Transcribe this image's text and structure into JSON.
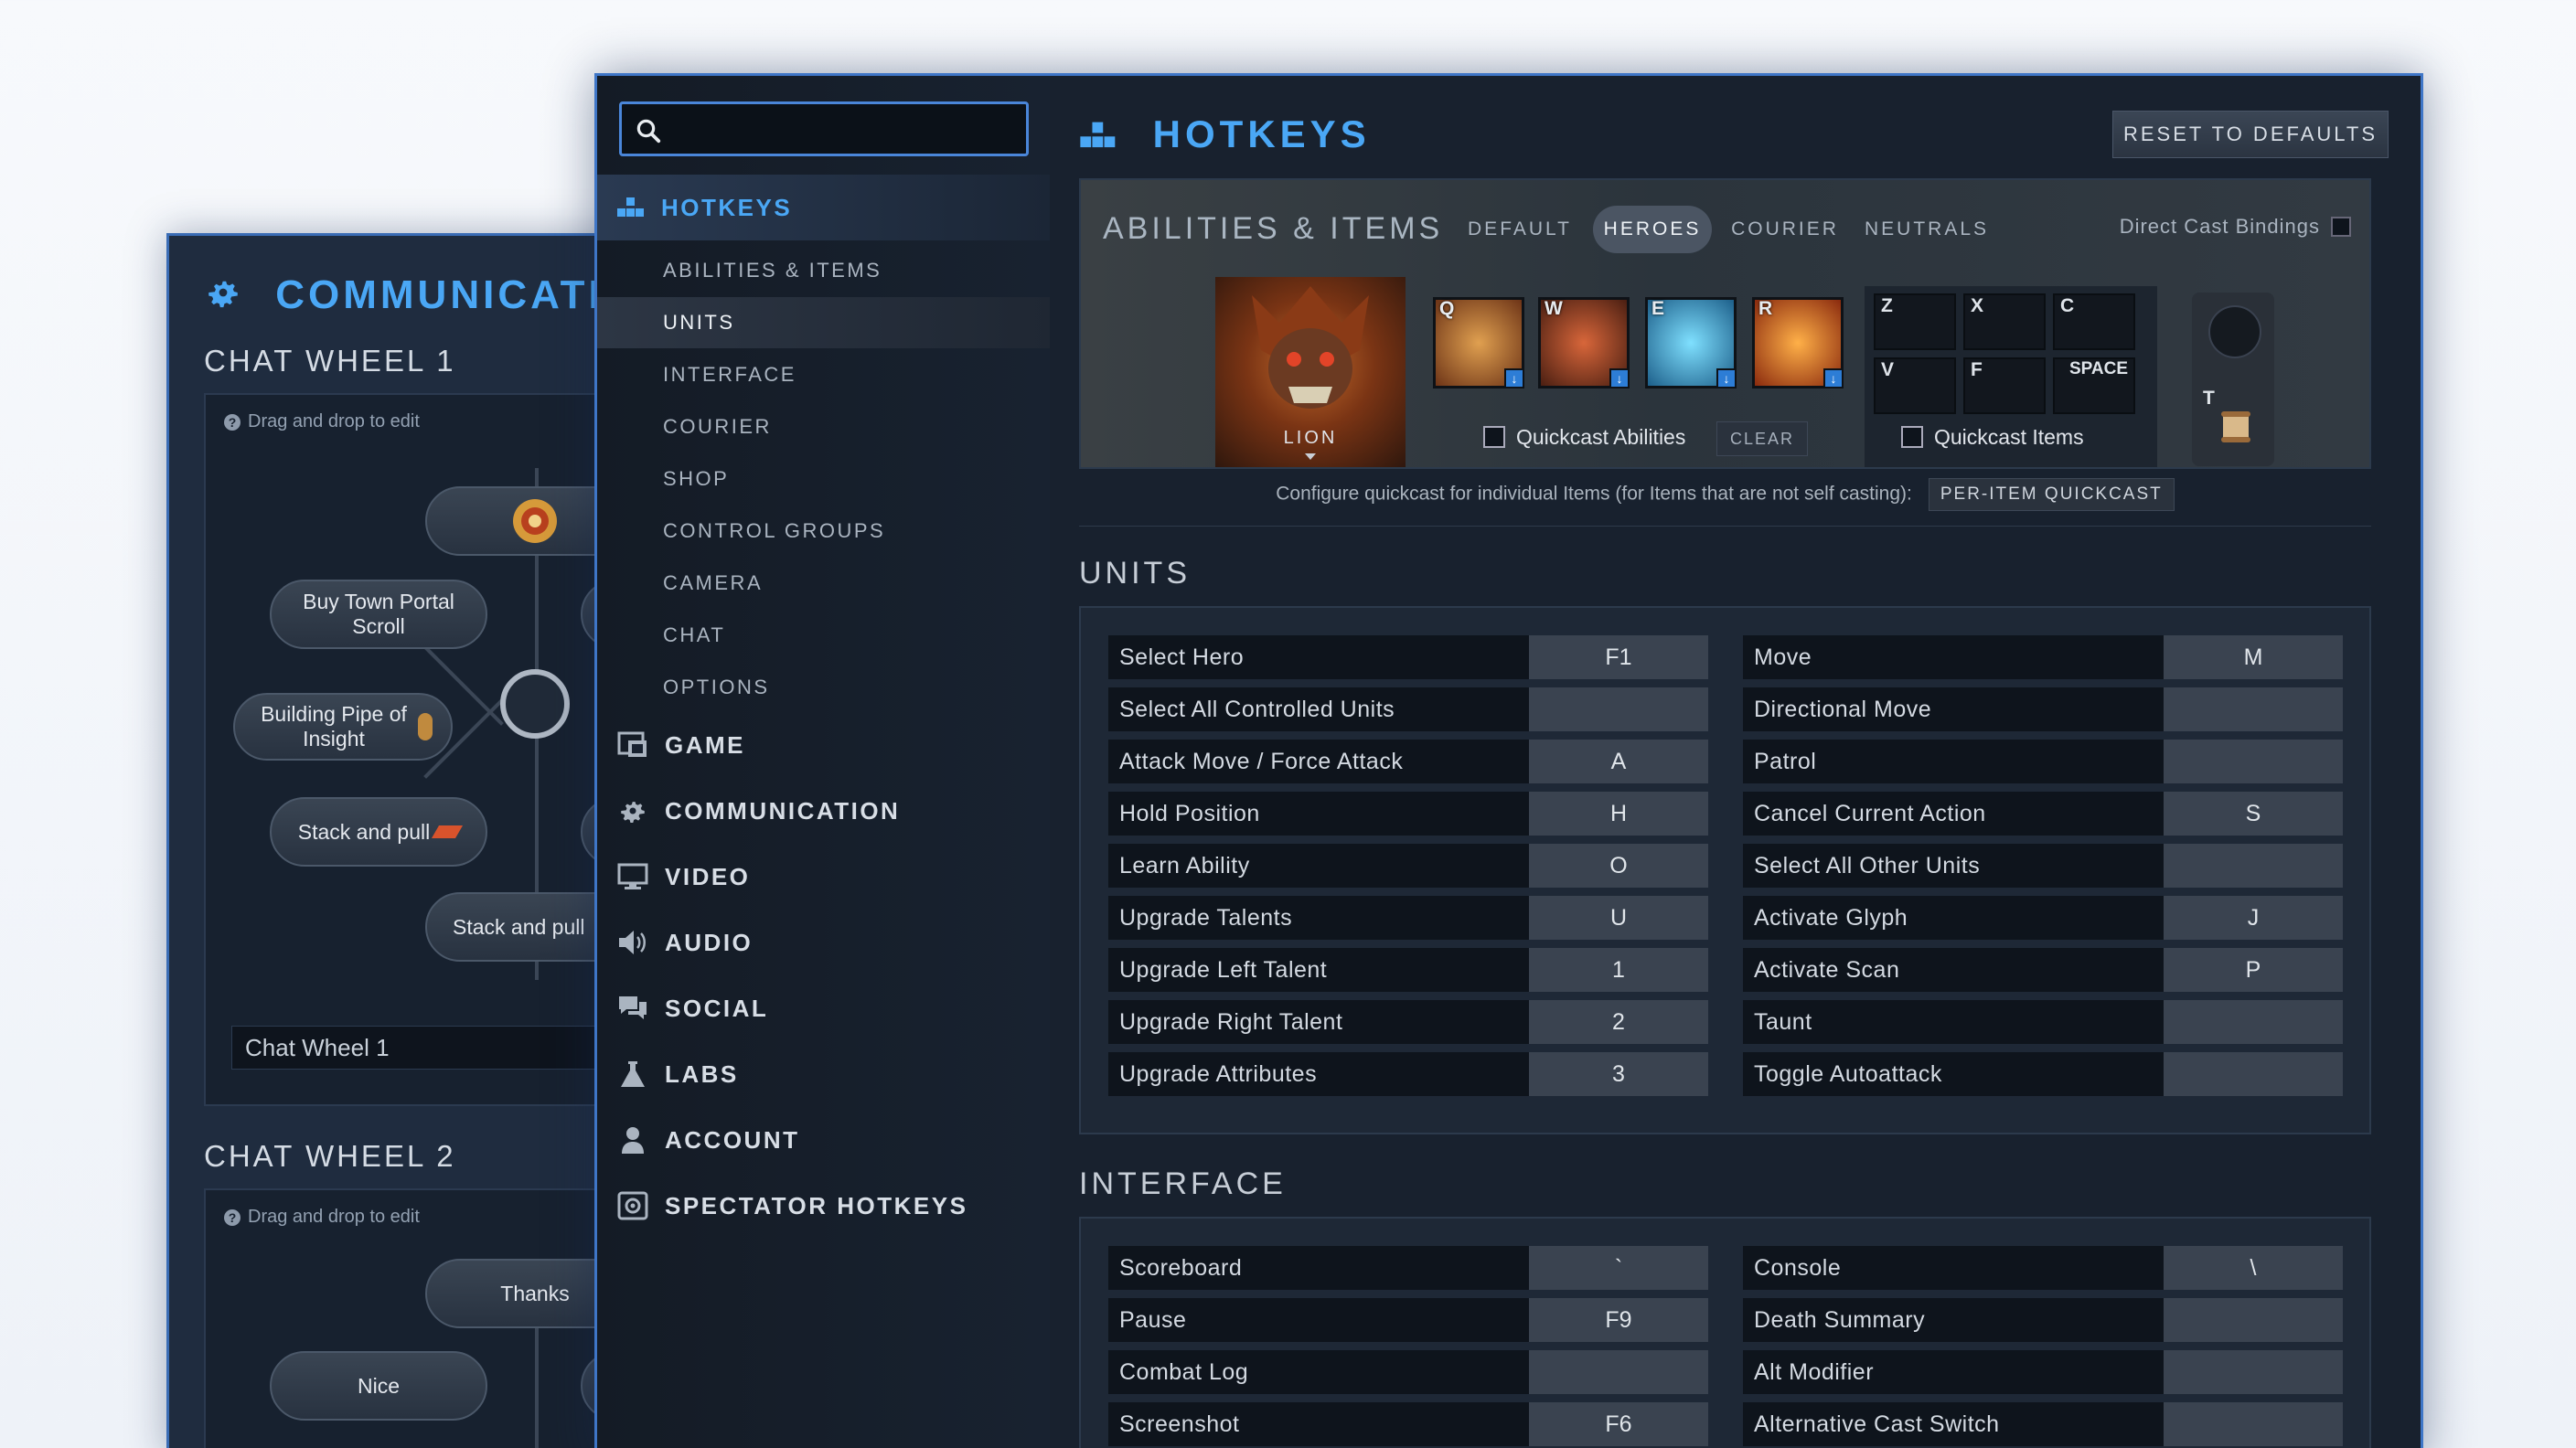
{
  "communication": {
    "title": "COMMUNICATION",
    "chat_wheel_1": {
      "title": "CHAT WHEEL 1",
      "hint": "Drag and drop to edit",
      "items": [
        "Buy Town Portal Scroll",
        "Building Pipe of Insight",
        "Stack and pull",
        "Stack and pull"
      ],
      "name_value": "Chat Wheel 1"
    },
    "chat_wheel_2": {
      "title": "CHAT WHEEL 2",
      "hint": "Drag and drop to edit",
      "items": [
        "Thanks",
        "Nice"
      ]
    }
  },
  "search": {
    "value": "",
    "placeholder": ""
  },
  "nav": {
    "hotkeys": "HOTKEYS",
    "sub": [
      "ABILITIES & ITEMS",
      "UNITS",
      "INTERFACE",
      "COURIER",
      "SHOP",
      "CONTROL GROUPS",
      "CAMERA",
      "CHAT",
      "OPTIONS"
    ],
    "sections": [
      "GAME",
      "COMMUNICATION",
      "VIDEO",
      "AUDIO",
      "SOCIAL",
      "LABS",
      "ACCOUNT",
      "SPECTATOR HOTKEYS"
    ]
  },
  "header": {
    "title": "HOTKEYS",
    "reset": "RESET TO DEFAULTS"
  },
  "abilities": {
    "title": "ABILITIES & ITEMS",
    "tabs": [
      "DEFAULT",
      "HEROES",
      "COURIER",
      "NEUTRALS"
    ],
    "active_tab": "HEROES",
    "direct_cast": "Direct Cast Bindings",
    "hero": "LION",
    "ability_keys": [
      "Q",
      "W",
      "E",
      "R"
    ],
    "quickcast_abilities": "Quickcast Abilities",
    "clear": "CLEAR",
    "item_keys": [
      "Z",
      "X",
      "C",
      "V",
      "F",
      "SPACE"
    ],
    "tp_key": "T",
    "quickcast_items": "Quickcast Items",
    "config_line": "Configure quickcast for individual Items (for Items that are not self casting):",
    "per_item": "PER-ITEM QUICKCAST"
  },
  "units": {
    "title": "UNITS",
    "left": [
      {
        "label": "Select Hero",
        "key": "F1"
      },
      {
        "label": "Select All Controlled Units",
        "key": ""
      },
      {
        "label": "Attack Move / Force Attack",
        "key": "A"
      },
      {
        "label": "Hold Position",
        "key": "H"
      },
      {
        "label": "Learn Ability",
        "key": "O"
      },
      {
        "label": "Upgrade Talents",
        "key": "U"
      },
      {
        "label": "Upgrade Left Talent",
        "key": "1"
      },
      {
        "label": "Upgrade Right Talent",
        "key": "2"
      },
      {
        "label": "Upgrade Attributes",
        "key": "3"
      }
    ],
    "right": [
      {
        "label": "Move",
        "key": "M"
      },
      {
        "label": "Directional Move",
        "key": ""
      },
      {
        "label": "Patrol",
        "key": ""
      },
      {
        "label": "Cancel Current Action",
        "key": "S"
      },
      {
        "label": "Select All Other Units",
        "key": ""
      },
      {
        "label": "Activate Glyph",
        "key": "J"
      },
      {
        "label": "Activate Scan",
        "key": "P"
      },
      {
        "label": "Taunt",
        "key": ""
      },
      {
        "label": "Toggle Autoattack",
        "key": ""
      }
    ]
  },
  "interface": {
    "title": "INTERFACE",
    "left": [
      {
        "label": "Scoreboard",
        "key": "`"
      },
      {
        "label": "Pause",
        "key": "F9"
      },
      {
        "label": "Combat Log",
        "key": ""
      },
      {
        "label": "Screenshot",
        "key": "F6"
      }
    ],
    "right": [
      {
        "label": "Console",
        "key": "\\"
      },
      {
        "label": "Death Summary",
        "key": ""
      },
      {
        "label": "Alt Modifier",
        "key": ""
      },
      {
        "label": "Alternative Cast Switch",
        "key": ""
      }
    ]
  },
  "colors": {
    "accent": "#4aa7f5",
    "panel": "#17202d",
    "border": "#3f76c7"
  }
}
